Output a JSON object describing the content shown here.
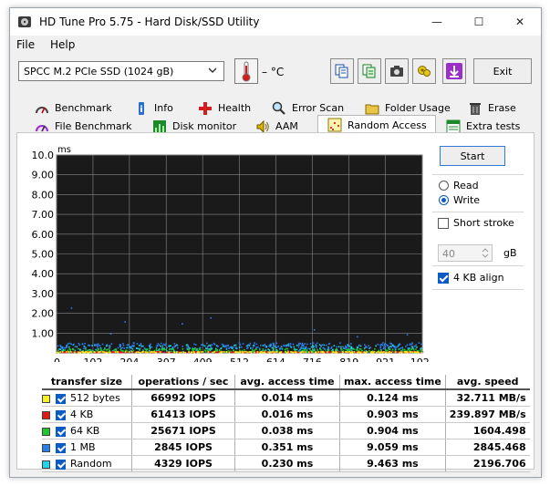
{
  "window": {
    "title": "HD Tune Pro 5.75 - Hard Disk/SSD Utility",
    "minimize_glyph": "—",
    "maximize_glyph": "☐",
    "close_glyph": "✕"
  },
  "menu": [
    {
      "label": "File"
    },
    {
      "label": "Help"
    }
  ],
  "toolbar": {
    "drive_selected": "SPCC M.2 PCIe SSD (1024 gB)",
    "temperature": "– °C",
    "exit_label": "Exit",
    "icons": [
      "copy-text-icon",
      "copy-info-icon",
      "screenshot-camera-icon",
      "options-icon",
      "save-arrow-icon"
    ]
  },
  "tabs_row1": [
    {
      "label": "Benchmark",
      "icon": "benchmark-icon"
    },
    {
      "label": "Info",
      "icon": "info-icon"
    },
    {
      "label": "Health",
      "icon": "health-cross-icon"
    },
    {
      "label": "Error Scan",
      "icon": "error-scan-icon"
    },
    {
      "label": "Folder Usage",
      "icon": "folder-icon"
    },
    {
      "label": "Erase",
      "icon": "trash-icon"
    }
  ],
  "tabs_row2": [
    {
      "label": "File Benchmark",
      "icon": "file-benchmark-icon"
    },
    {
      "label": "Disk monitor",
      "icon": "disk-monitor-icon"
    },
    {
      "label": "AAM",
      "icon": "speaker-icon"
    },
    {
      "label": "Random Access",
      "icon": "random-access-icon",
      "active": true
    },
    {
      "label": "Extra tests",
      "icon": "extra-tests-icon"
    }
  ],
  "controls": {
    "start_label": "Start",
    "read_label": "Read",
    "write_label": "Write",
    "mode_selected": "Write",
    "short_stroke_label": "Short stroke",
    "short_stroke_checked": false,
    "short_stroke_value": "40",
    "gb_unit": "gB",
    "align_label": "4 KB align",
    "align_checked": true
  },
  "chart_data": {
    "type": "scatter",
    "ylabel": "ms",
    "ylim": [
      0,
      10
    ],
    "xlim": [
      0,
      1024
    ],
    "xunit": "gB",
    "y_ticks": [
      "1.00",
      "2.00",
      "3.00",
      "4.00",
      "5.00",
      "6.00",
      "7.00",
      "8.00",
      "9.00",
      "10.0"
    ],
    "x_ticks": [
      "0",
      "102",
      "204",
      "307",
      "409",
      "512",
      "614",
      "716",
      "819",
      "921",
      "1024gB"
    ],
    "grid": true,
    "background": "#1a1a1a",
    "series": [
      {
        "name": "Random",
        "color": "#22d3e8",
        "approx_y_range": [
          0.05,
          0.4
        ]
      },
      {
        "name": "1 MB",
        "color": "#2b7de9",
        "approx_y_range": [
          0.2,
          0.5
        ]
      },
      {
        "name": "64 KB",
        "color": "#22c72e",
        "approx_y_range": [
          0.02,
          0.2
        ]
      },
      {
        "name": "4 KB",
        "color": "#e01b1b",
        "approx_y_range": [
          0.0,
          0.05
        ]
      },
      {
        "name": "512 bytes",
        "color": "#f2e21a",
        "approx_y_range": [
          0.0,
          0.05
        ]
      }
    ]
  },
  "results": {
    "headers": [
      "transfer size",
      "operations / sec",
      "avg. access time",
      "max. access time",
      "avg. speed"
    ],
    "rows": [
      {
        "label": "512 bytes",
        "color": "#f7ef2a",
        "ops": "66992 IOPS",
        "avg": "0.014 ms",
        "max": "0.124 ms",
        "speed": "32.711 MB/s"
      },
      {
        "label": "4 KB",
        "color": "#e01b1b",
        "ops": "61413 IOPS",
        "avg": "0.016 ms",
        "max": "0.903 ms",
        "speed": "239.897 MB/s"
      },
      {
        "label": "64 KB",
        "color": "#22c72e",
        "ops": "25671 IOPS",
        "avg": "0.038 ms",
        "max": "0.904 ms",
        "speed": "1604.498"
      },
      {
        "label": "1 MB",
        "color": "#2b7de9",
        "ops": "2845 IOPS",
        "avg": "0.351 ms",
        "max": "9.059 ms",
        "speed": "2845.468"
      },
      {
        "label": "Random",
        "color": "#22d3e8",
        "ops": "4329 IOPS",
        "avg": "0.230 ms",
        "max": "9.463 ms",
        "speed": "2196.706"
      }
    ]
  }
}
